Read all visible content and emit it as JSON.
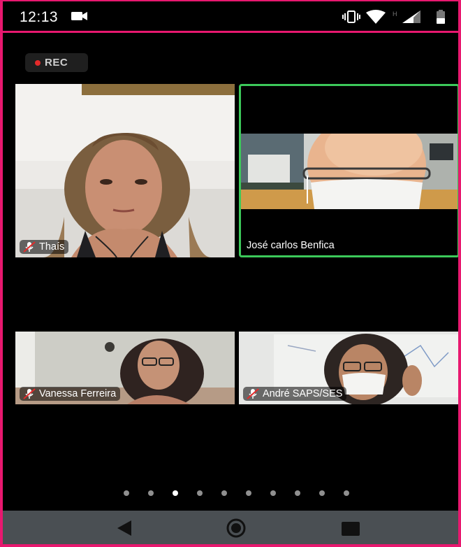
{
  "status_bar": {
    "time": "12:13",
    "icons": [
      "video-camera-icon",
      "vibrate-icon",
      "wifi-icon",
      "signal-h-icon",
      "battery-icon"
    ]
  },
  "recording": {
    "label": "REC",
    "dot_color": "#e42a2a"
  },
  "participants": [
    {
      "name": "Thaís",
      "muted": true,
      "active_speaker": false
    },
    {
      "name": "José carlos Benfica",
      "muted": false,
      "active_speaker": true
    },
    {
      "name": "Vanessa Ferreira",
      "muted": true,
      "active_speaker": false
    },
    {
      "name": "André SAPS/SES",
      "muted": true,
      "active_speaker": false
    }
  ],
  "pager": {
    "pages": 10,
    "current": 3
  },
  "nav_bar": {
    "buttons": [
      "back-icon",
      "home-icon",
      "recents-icon"
    ]
  },
  "colors": {
    "frame": "#e8186f",
    "active_speaker_border": "#3cc95a",
    "nav_bar": "#4a4f53"
  }
}
